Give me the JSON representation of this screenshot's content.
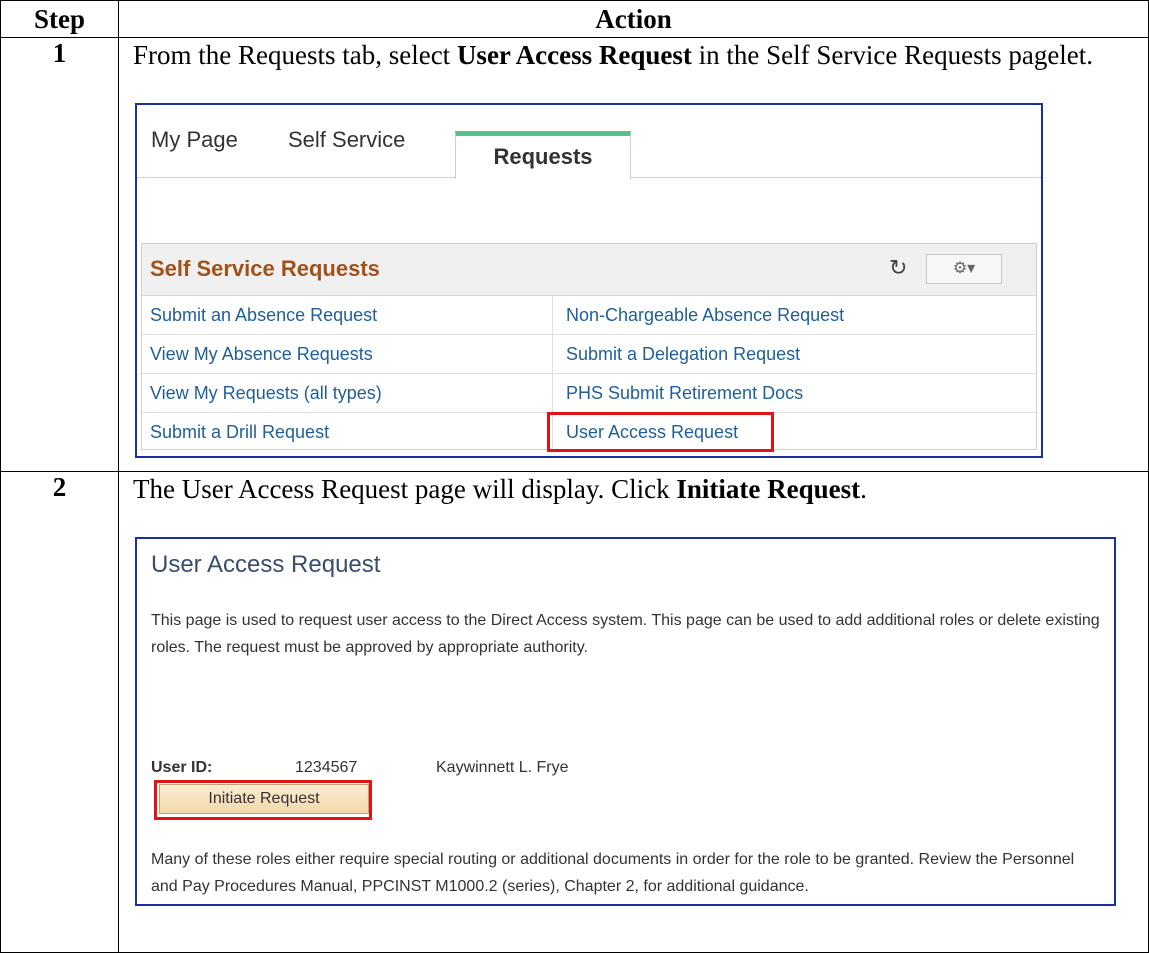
{
  "table": {
    "header_step": "Step",
    "header_action": "Action"
  },
  "step1": {
    "number": "1",
    "text_a": "From the Requests tab, select ",
    "text_bold": "User Access Request",
    "text_b": " in the Self Service Requests pagelet."
  },
  "step2": {
    "number": "2",
    "text_a": "The User Access Request page will display.  Click ",
    "text_bold": "Initiate Request",
    "text_b": "."
  },
  "shot1": {
    "tabs": [
      "My Page",
      "Self Service",
      "Requests"
    ],
    "pagelet_title": "Self Service Requests",
    "refresh_icon": "refresh-icon",
    "gear_icon": "gear-icon",
    "gear_glyph": "⚙▾",
    "refresh_glyph": "↻",
    "links_left": [
      "Submit an Absence Request",
      "View My Absence Requests",
      "View My Requests (all types)",
      "Submit a Drill Request"
    ],
    "links_right": [
      "Non-Chargeable Absence Request",
      "Submit a Delegation Request",
      "PHS Submit Retirement Docs",
      "User Access Request"
    ],
    "highlight_color": "#e01414"
  },
  "shot2": {
    "title": "User Access Request",
    "description": "This page is used to request user access to the Direct Access system. This page can be used to add additional roles or delete existing roles. The request must be approved by appropriate authority.",
    "user_id_label": "User ID:",
    "user_id": "1234567",
    "user_name": "Kaywinnett L. Frye",
    "button_label": "Initiate Request",
    "footer": "Many of these roles either require special routing or additional documents in order for the role to be granted. Review the Personnel and Pay Procedures Manual, PPCINST M1000.2 (series), Chapter 2, for additional guidance."
  }
}
